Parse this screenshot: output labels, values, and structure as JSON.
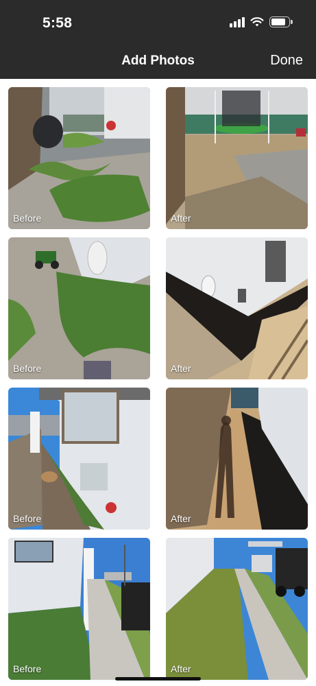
{
  "status_bar": {
    "time": "5:58",
    "icons": [
      "cellular-signal-icon",
      "wifi-icon",
      "battery-icon"
    ]
  },
  "header": {
    "title": "Add Photos",
    "done_label": "Done"
  },
  "photos": [
    {
      "label": "Before",
      "scene": "side yard with overgrown weeds, trampoline and grill"
    },
    {
      "label": "After",
      "scene": "cleared side yard with trampoline"
    },
    {
      "label": "Before",
      "scene": "weedy strip along house wall"
    },
    {
      "label": "After",
      "scene": "black mulch strip along house wall"
    },
    {
      "label": "Before",
      "scene": "narrow weedy walkway between fence and house"
    },
    {
      "label": "After",
      "scene": "mulched walkway with shadow of person"
    },
    {
      "label": "Before",
      "scene": "front strip with grass and sidewalk"
    },
    {
      "label": "After",
      "scene": "trimmed front strip with sidewalk"
    }
  ],
  "colors": {
    "header_bg": "#2b2b2b",
    "header_text": "#ffffff",
    "page_bg": "#ffffff"
  }
}
